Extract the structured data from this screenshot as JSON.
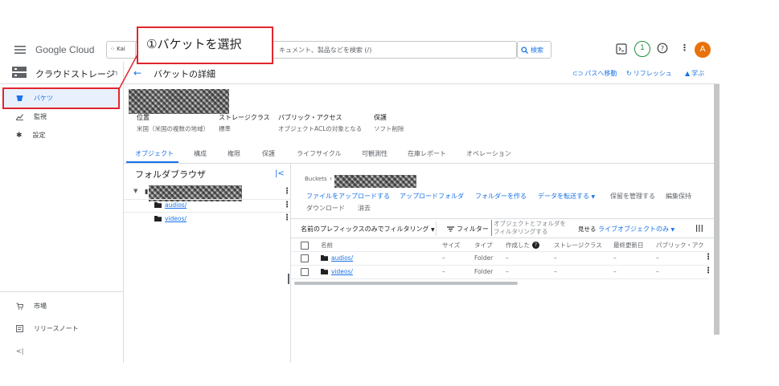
{
  "topbar": {
    "logo_google": "Google",
    "logo_cloud": "Cloud",
    "project_label": "Kai",
    "search_placeholder": "キュメント、製品などを検索 (/)",
    "search_button": "検索",
    "notification_count": "1",
    "avatar_letter": "A"
  },
  "callout": {
    "text": "①バケットを選択",
    "color": "#e0262e"
  },
  "nav": {
    "title": "クラウドストレージ",
    "items": [
      {
        "label": "バケツ",
        "icon": "bucket-icon"
      },
      {
        "label": "監視",
        "icon": "chart-icon"
      },
      {
        "label": "設定",
        "icon": "gear-icon"
      }
    ],
    "bottom_items": [
      {
        "label": "市場",
        "icon": "cart-icon"
      },
      {
        "label": "リリースノート",
        "icon": "notes-icon"
      }
    ],
    "collapse": "<|"
  },
  "header": {
    "title": "バケットの詳細",
    "actions": [
      {
        "label": "パスへ移動",
        "icon": "link-icon"
      },
      {
        "label": "リフレッシュ",
        "icon": "refresh-icon"
      },
      {
        "label": "学ぶ",
        "icon": "school-icon"
      }
    ]
  },
  "bucket_meta": {
    "location_label": "位置",
    "location_value": "米国（米国の複数の地域）",
    "storage_class_label": "ストレージクラス",
    "storage_class_value": "標準",
    "public_access_label": "パブリック・アクセス",
    "public_access_value": "オブジェクトACLの対象となる",
    "protection_label": "保護",
    "protection_value": "ソフト削除"
  },
  "tabs": [
    "オブジェクト",
    "構成",
    "権限",
    "保護",
    "ライフサイクル",
    "可観測性",
    "在庫レポート",
    "オペレーション"
  ],
  "folder_browser": {
    "title": "フォルダブラウザ",
    "folders": [
      "audios/",
      "videos/"
    ]
  },
  "objects": {
    "breadcrumb_label": "Buckets",
    "actions": [
      "ファイルをアップロードする",
      "アップロードフォルダ",
      "フォルダーを作る",
      "データを転送する",
      "保留を管理する",
      "編集保持"
    ],
    "delete_group": [
      "ダウンロード",
      "消去"
    ],
    "filter_prefix": "名前のプレフィックスのみでフィルタリング",
    "filter_button": "フィルター",
    "filter_placeholder_1": "オブジェクトとフォルダを",
    "filter_placeholder_2": "フィルタリングする",
    "show_label": "見せる",
    "show_value": "ライブオブジェクトのみ",
    "columns": [
      "名前",
      "サイズ",
      "タイプ",
      "作成した",
      "ストレージクラス",
      "最終更新日",
      "パブリック・アク"
    ],
    "rows": [
      {
        "name": "audios/",
        "size": "–",
        "type": "Folder",
        "created": "–",
        "storage": "–",
        "updated": "–",
        "public": "–"
      },
      {
        "name": "videos/",
        "size": "–",
        "type": "Folder",
        "created": "–",
        "storage": "–",
        "updated": "–",
        "public": "–"
      }
    ]
  }
}
